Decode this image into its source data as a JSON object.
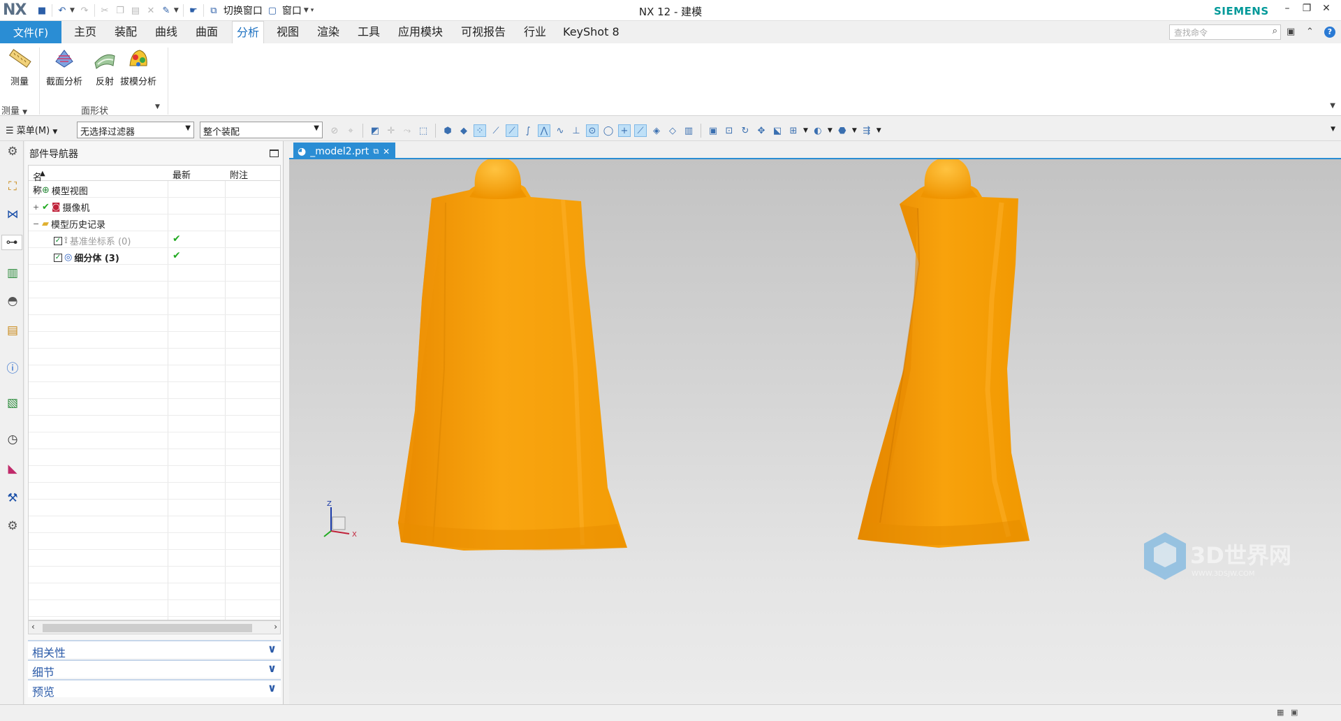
{
  "app": {
    "logo": "NX",
    "title": "NX 12 - 建模",
    "brand": "SIEMENS"
  },
  "quick_access": {
    "switch_window": "切换窗口",
    "window": "窗口"
  },
  "menu": {
    "file": "文件(F)",
    "tabs": [
      "主页",
      "装配",
      "曲线",
      "曲面",
      "分析",
      "视图",
      "渲染",
      "工具",
      "应用模块",
      "可视报告",
      "行业",
      "KeyShot 8"
    ],
    "active_tab": "分析",
    "command_search_placeholder": "查找命令"
  },
  "ribbon": {
    "buttons": [
      {
        "label": "测量",
        "icon": "ruler-icon"
      },
      {
        "label": "截面分析",
        "icon": "section-analysis-icon"
      },
      {
        "label": "反射",
        "icon": "reflection-icon"
      },
      {
        "label": "拔模分析",
        "icon": "draft-analysis-icon"
      }
    ],
    "groups": [
      "测量",
      "面形状"
    ]
  },
  "selection_bar": {
    "menu": "菜单(M)",
    "filter": "无选择过滤器",
    "scope": "整个装配"
  },
  "navigator": {
    "title": "部件导航器",
    "columns": [
      "名称",
      "最新",
      "附注"
    ],
    "rows": [
      {
        "expander": "+",
        "label": "模型视图",
        "icon": "model-views-icon",
        "latest": "",
        "style": "normal"
      },
      {
        "expander": "+",
        "label": "摄像机",
        "icon": "camera-icon",
        "latest": "",
        "style": "normal"
      },
      {
        "expander": "−",
        "label": "模型历史记录",
        "icon": "folder-icon",
        "latest": "",
        "style": "normal"
      },
      {
        "expander": "",
        "label": "基准坐标系 (0)",
        "icon": "datum-csys-icon",
        "latest": "✔",
        "style": "dim"
      },
      {
        "expander": "",
        "label": "细分体 (3)",
        "icon": "subdivision-body-icon",
        "latest": "✔",
        "style": "bold"
      }
    ],
    "sections": [
      "相关性",
      "细节",
      "预览"
    ]
  },
  "graphics": {
    "doc_tab": "_model2.prt",
    "triad": {
      "z": "Z",
      "x": "X"
    },
    "part_color": "#f59a00",
    "watermark": "3D世界网",
    "watermark_url": "WWW.3DSJW.COM"
  }
}
